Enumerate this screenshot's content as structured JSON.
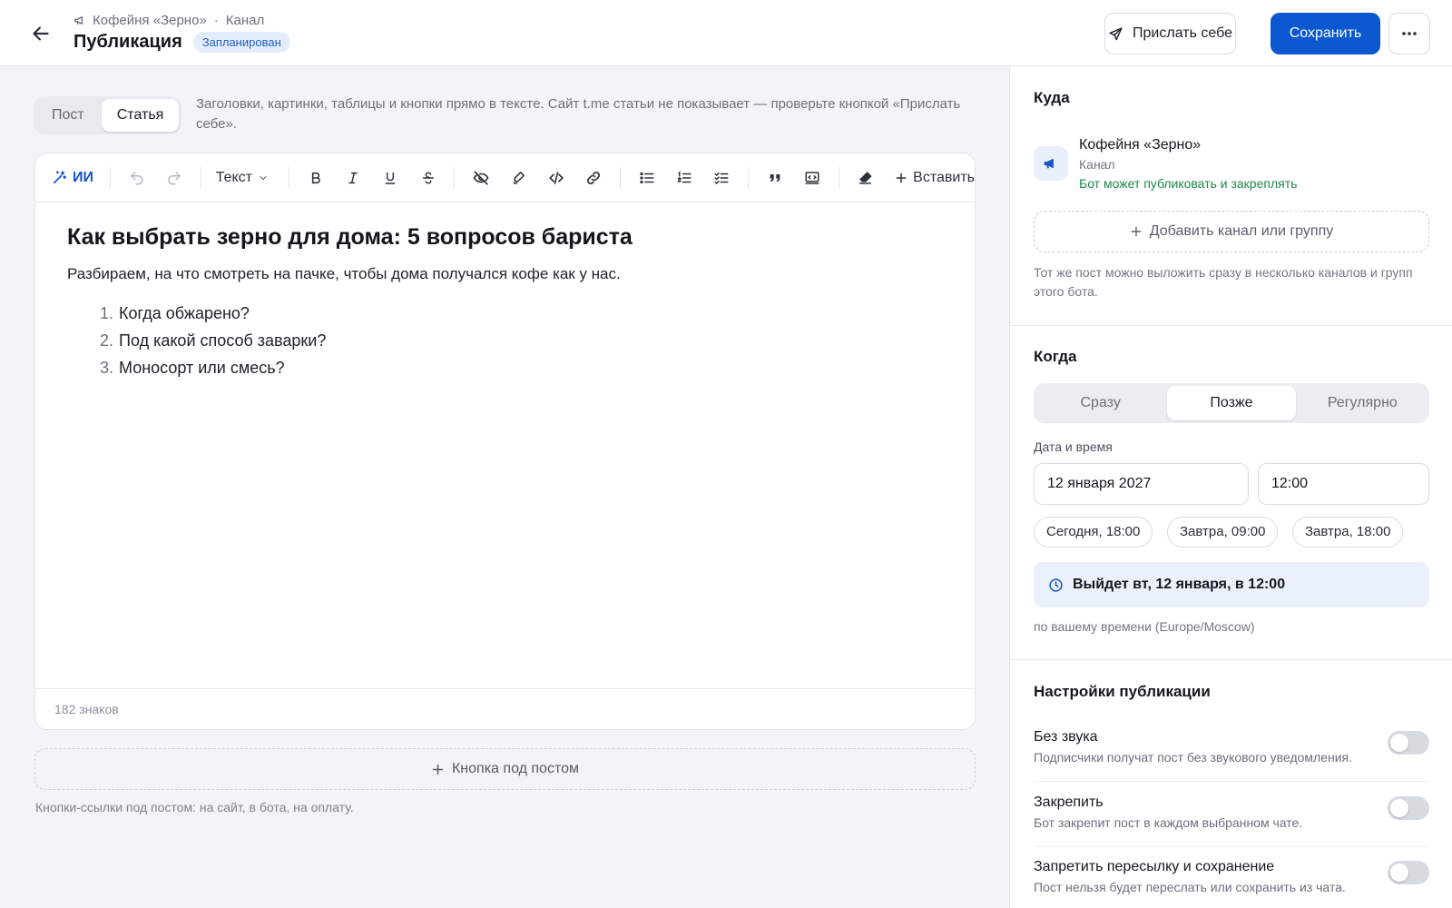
{
  "header": {
    "channel_name": "Кофейня «Зерно»",
    "channel_type": "Канал",
    "title": "Публикация",
    "status_badge": "Запланирован",
    "send_self_label": "Прислать себе",
    "save_label": "Сохранить"
  },
  "mode_tabs": [
    {
      "label": "Пост",
      "active": false
    },
    {
      "label": "Статья",
      "active": true
    }
  ],
  "mode_hint": "Заголовки, картинки, таблицы и кнопки прямо в тексте. Сайт t.me статьи не показывает — проверьте кнопкой «Прислать себе».",
  "toolbar": {
    "ai_label": "ИИ",
    "text_style_label": "Текст",
    "insert_label": "Вставить"
  },
  "article": {
    "heading": "Как выбрать зерно для дома: 5 вопросов бариста",
    "lead": "Разбираем, на что смотреть на пачке, чтобы дома получался кофе как у нас.",
    "list": [
      {
        "num": "1.",
        "text": "Когда обжарено?"
      },
      {
        "num": "2.",
        "text": "Под какой способ заварки?"
      },
      {
        "num": "3.",
        "text": "Моносорт или смесь?"
      }
    ],
    "char_count": "182 знаков"
  },
  "post_button": {
    "label": "Кнопка под постом",
    "hint": "Кнопки-ссылки под постом: на сайт, в бота, на оплату."
  },
  "sidebar": {
    "where": {
      "title": "Куда",
      "channel_name": "Кофейня «Зерно»",
      "channel_type": "Канал",
      "channel_status": "Бот может публиковать и закреплять",
      "add_label": "Добавить канал или группу",
      "add_hint": "Тот же пост можно выложить сразу в несколько каналов и групп этого бота."
    },
    "when": {
      "title": "Когда",
      "options": [
        {
          "label": "Сразу",
          "active": false
        },
        {
          "label": "Позже",
          "active": true
        },
        {
          "label": "Регулярно",
          "active": false
        }
      ],
      "datetime_label": "Дата и время",
      "date_value": "12 января 2027",
      "time_value": "12:00",
      "quick_chips": [
        "Сегодня, 18:00",
        "Завтра, 09:00",
        "Завтра, 18:00"
      ],
      "publish_info": "Выйдет вт, 12 января, в 12:00",
      "tz_hint": "по вашему времени (Europe/Moscow)"
    },
    "settings": {
      "title": "Настройки публикации",
      "items": [
        {
          "title": "Без звука",
          "desc": "Подписчики получат пост без звукового уведомления.",
          "on": false
        },
        {
          "title": "Закрепить",
          "desc": "Бот закрепит пост в каждом выбранном чате.",
          "on": false
        },
        {
          "title": "Запретить пересылку и сохранение",
          "desc": "Пост нельзя будет переслать или сохранить из чата.",
          "on": false
        }
      ]
    }
  },
  "colors": {
    "accent": "#0b57d0",
    "status_green": "#1e8a4a",
    "badge_bg": "#e3edfb"
  }
}
